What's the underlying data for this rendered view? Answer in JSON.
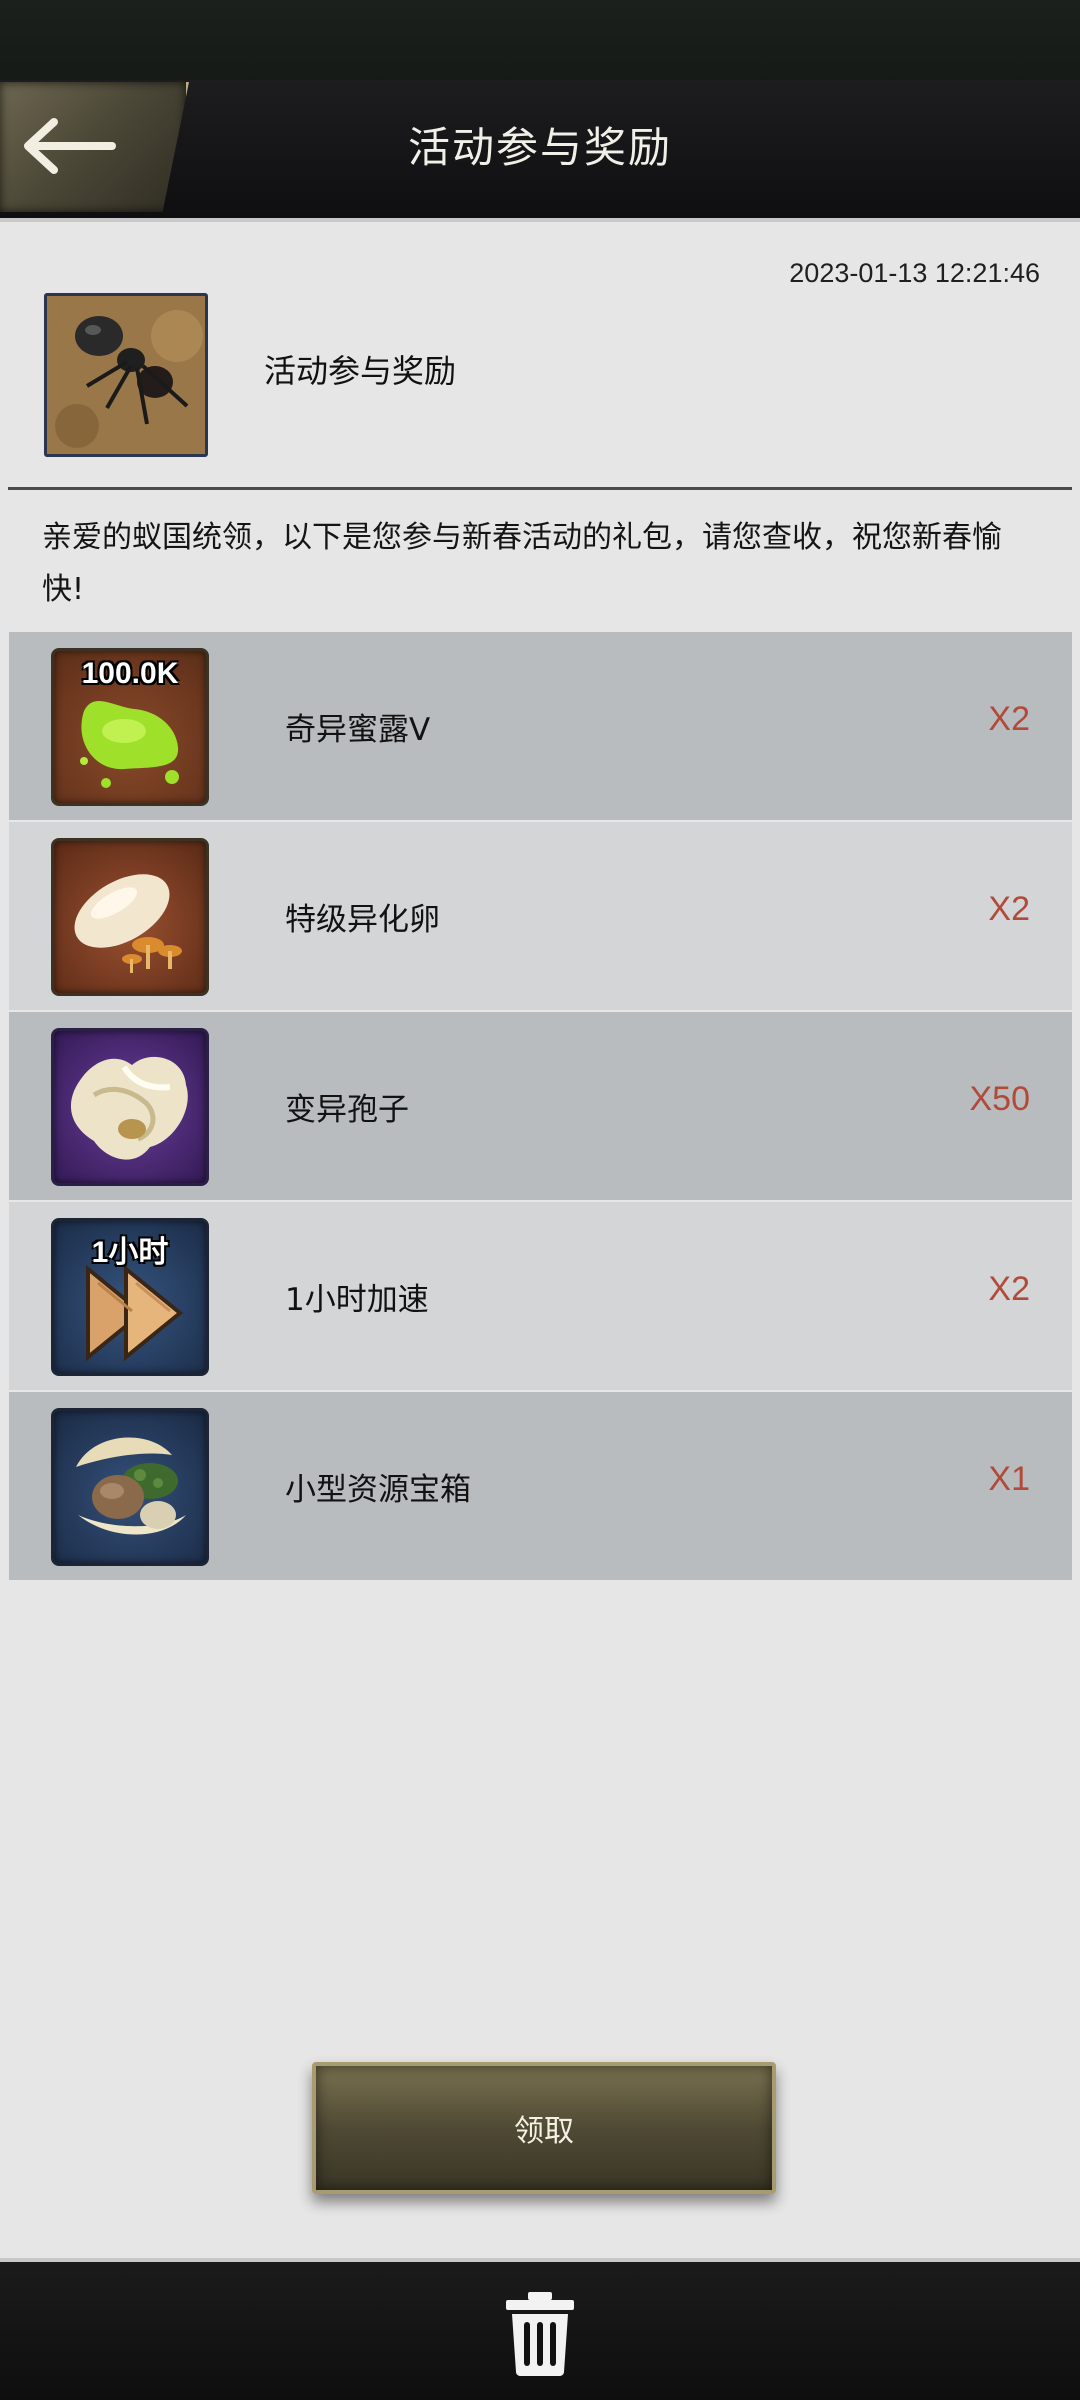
{
  "header": {
    "title": "活动参与奖励"
  },
  "mail": {
    "timestamp": "2023-01-13 12:21:46",
    "subject": "活动参与奖励",
    "body": "亲爱的蚁国统领，以下是您参与新春活动的礼包，请您查收，祝您新春愉快!"
  },
  "rewards": [
    {
      "name": "奇异蜜露V",
      "qty": "X2",
      "badge": "100.0K",
      "icon": "honeydew-icon"
    },
    {
      "name": "特级异化卵",
      "qty": "X2",
      "badge": "",
      "icon": "mutant-egg-icon"
    },
    {
      "name": "变异孢子",
      "qty": "X50",
      "badge": "",
      "icon": "spore-icon"
    },
    {
      "name": "1小时加速",
      "qty": "X2",
      "badge": "1小时",
      "icon": "speedup-icon"
    },
    {
      "name": "小型资源宝箱",
      "qty": "X1",
      "badge": "",
      "icon": "resource-chest-icon"
    }
  ],
  "actions": {
    "claim_label": "领取"
  },
  "colors": {
    "quantity": "#b24a3a",
    "header_bg": "#141416",
    "row_dark": "#b9bcbf",
    "row_light": "#d3d5d7"
  }
}
